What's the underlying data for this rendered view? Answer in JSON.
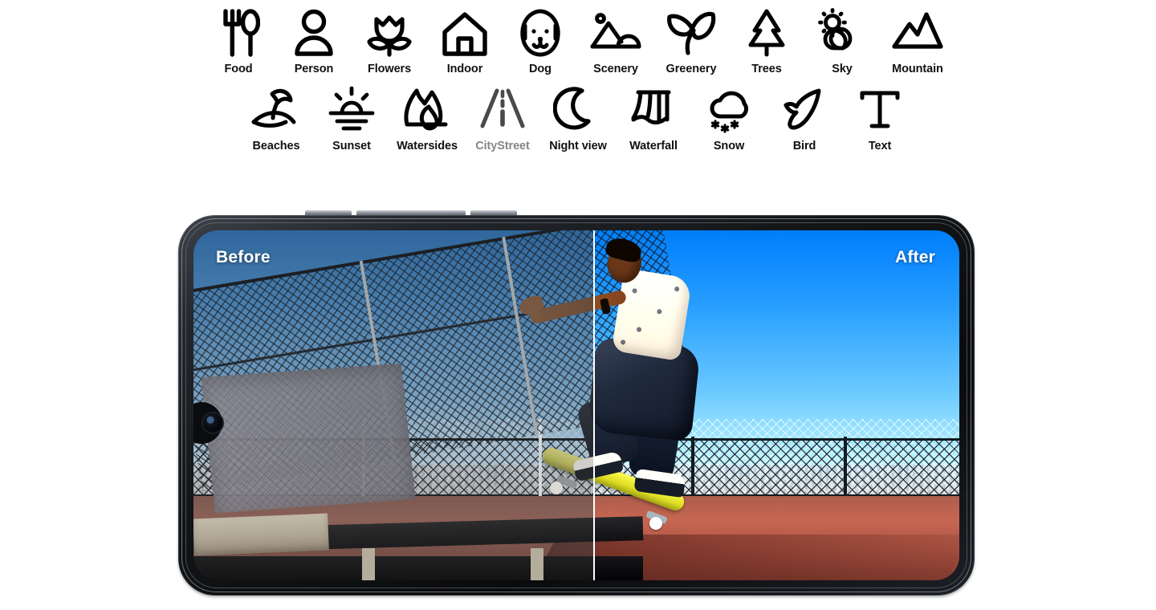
{
  "scene_categories": {
    "row1": [
      {
        "label": "Food",
        "icon": "fork-spoon-icon",
        "dim": false
      },
      {
        "label": "Person",
        "icon": "person-icon",
        "dim": false
      },
      {
        "label": "Flowers",
        "icon": "tulip-icon",
        "dim": false
      },
      {
        "label": "Indoor",
        "icon": "house-icon",
        "dim": false
      },
      {
        "label": "Dog",
        "icon": "dog-face-icon",
        "dim": false
      },
      {
        "label": "Scenery",
        "icon": "landscape-icon",
        "dim": false
      },
      {
        "label": "Greenery",
        "icon": "leaf-sprout-icon",
        "dim": false
      },
      {
        "label": "Trees",
        "icon": "pine-tree-icon",
        "dim": false
      },
      {
        "label": "Sky",
        "icon": "sun-cloud-icon",
        "dim": false
      },
      {
        "label": "Mountain",
        "icon": "mountain-icon",
        "dim": false
      }
    ],
    "row2": [
      {
        "label": "Beaches",
        "icon": "beach-umbrella-icon",
        "dim": false
      },
      {
        "label": "Sunset",
        "icon": "sunset-icon",
        "dim": false
      },
      {
        "label": "Watersides",
        "icon": "waterside-icon",
        "dim": false
      },
      {
        "label": "CityStreet",
        "icon": "road-icon",
        "dim": true
      },
      {
        "label": "Night view",
        "icon": "crescent-moon-icon",
        "dim": false
      },
      {
        "label": "Waterfall",
        "icon": "waterfall-icon",
        "dim": false
      },
      {
        "label": "Snow",
        "icon": "snow-cloud-icon",
        "dim": false
      },
      {
        "label": "Bird",
        "icon": "bird-icon",
        "dim": false
      },
      {
        "label": "Text",
        "icon": "text-t-icon",
        "dim": false
      }
    ]
  },
  "comparison": {
    "before_label": "Before",
    "after_label": "After",
    "subject": "skateboarder performing a trick on a ledge at a skatepark",
    "divider_color": "#ffffff",
    "label_color": "#ffffff"
  },
  "device": {
    "orientation": "landscape",
    "frame_color": "#101214",
    "camera": "front-camera-punch-hole"
  },
  "colors": {
    "label_default": "#111111",
    "label_dim": "#868686",
    "icon_default": "#000000",
    "icon_dim": "#4a4a4a",
    "background": "#ffffff"
  }
}
